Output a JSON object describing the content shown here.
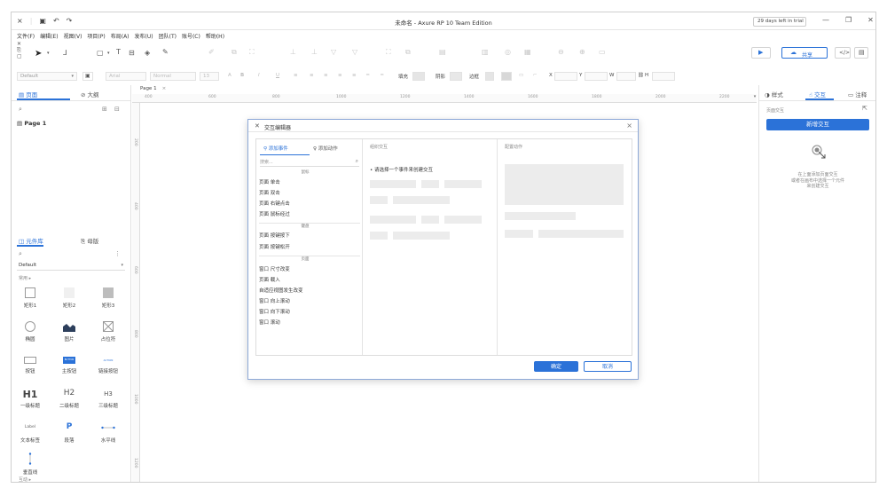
{
  "window": {
    "title": "未命名 - Axure RP 10 Team Edition",
    "trial_label": "29 days left in trial"
  },
  "menu": [
    "文件(F)",
    "编辑(E)",
    "视图(V)",
    "项目(P)",
    "布局(A)",
    "发布(U)",
    "团队(T)",
    "账号(C)",
    "帮助(H)"
  ],
  "toolbar": {
    "share_label": "共享"
  },
  "format": {
    "style_select": "Default",
    "font_select": "Arial",
    "weight_select": "Normal",
    "size_select": "13",
    "fill_label": "填充",
    "shadow_label": "阴影",
    "border_label": "边框",
    "x_label": "X",
    "y_label": "Y",
    "w_label": "W",
    "h_label": "H"
  },
  "left_panel": {
    "tab_pages": "页面",
    "tab_outline": "大纲",
    "page_item": "Page 1",
    "tab_library": "元件库",
    "tab_masters": "母版",
    "library_select": "Default",
    "section_label": "常用 ▸",
    "widgets": [
      {
        "label": "矩形1",
        "icon": "rect-outline-icon"
      },
      {
        "label": "矩形2",
        "icon": "rect-light-icon"
      },
      {
        "label": "矩形3",
        "icon": "rect-gray-icon"
      },
      {
        "label": "椭圆",
        "icon": "ellipse-icon"
      },
      {
        "label": "图片",
        "icon": "image-icon"
      },
      {
        "label": "占位符",
        "icon": "placeholder-icon"
      },
      {
        "label": "按钮",
        "icon": "button-icon"
      },
      {
        "label": "主按钮",
        "icon": "primary-button-icon"
      },
      {
        "label": "链接按钮",
        "icon": "link-button-icon"
      },
      {
        "label": "一级标题",
        "icon": "h1-icon"
      },
      {
        "label": "二级标题",
        "icon": "h2-icon"
      },
      {
        "label": "三级标题",
        "icon": "h3-icon"
      },
      {
        "label": "文本标签",
        "icon": "label-icon"
      },
      {
        "label": "段落",
        "icon": "paragraph-icon"
      },
      {
        "label": "水平线",
        "icon": "hline-icon"
      },
      {
        "label": "垂直线",
        "icon": "vline-icon"
      }
    ],
    "icon_text": {
      "h1": "H1",
      "h2": "H2",
      "h3": "H3",
      "label": "Label",
      "paragraph": "P",
      "button_small": "BUTTON",
      "link_small": "ACTION"
    },
    "bottom_hint": "互动 ▸"
  },
  "canvas": {
    "page_tab": "Page 1",
    "ruler_h": [
      "400",
      "600",
      "800",
      "1000",
      "1200",
      "1400",
      "1600",
      "1800",
      "2000",
      "2200"
    ],
    "ruler_v": [
      "200",
      "400",
      "600",
      "800",
      "1000",
      "1200"
    ]
  },
  "right_panel": {
    "tab_style": "样式",
    "tab_interaction": "交互",
    "tab_notes": "注释",
    "section_label": "页面交互",
    "new_interaction": "新增交互",
    "hint_line1": "在上面添加页面交互",
    "hint_line2": "或者在画布中选择一个元件",
    "hint_line3": "来创建交互"
  },
  "dialog": {
    "title": "交互编辑器",
    "tab_event": "添加事件",
    "tab_action": "添加动作",
    "search_placeholder": "搜索...",
    "col2_title": "组织交互",
    "col3_title": "配置动作",
    "instruction": "请选择一个事件来创建交互",
    "groups": {
      "mouse": "鼠标",
      "keyboard": "键盘",
      "page": "页面"
    },
    "mouse_events": [
      "页面 单击",
      "页面 双击",
      "页面 右键点击",
      "页面 鼠标经过"
    ],
    "keyboard_events": [
      "页面 按键按下",
      "页面 按键松开"
    ],
    "page_events": [
      "窗口 尺寸改变",
      "页面 载入",
      "自适应视图发生改变",
      "窗口 向上滚动",
      "窗口 向下滚动",
      "窗口 滚动"
    ],
    "ok_label": "确定",
    "cancel_label": "取消"
  }
}
